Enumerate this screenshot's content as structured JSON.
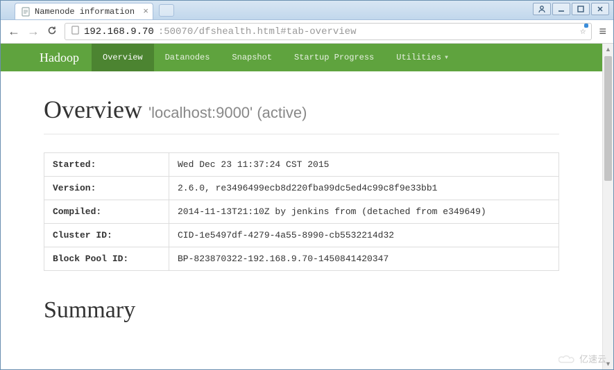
{
  "browser": {
    "tab_title": "Namenode information",
    "url_host": "192.168.9.70",
    "url_rest": ":50070/dfshealth.html#tab-overview"
  },
  "navbar": {
    "brand": "Hadoop",
    "items": [
      {
        "label": "Overview",
        "active": true
      },
      {
        "label": "Datanodes",
        "active": false
      },
      {
        "label": "Snapshot",
        "active": false
      },
      {
        "label": "Startup Progress",
        "active": false
      },
      {
        "label": "Utilities",
        "active": false,
        "dropdown": true
      }
    ]
  },
  "overview": {
    "heading": "Overview",
    "subtitle": "'localhost:9000' (active)",
    "rows": [
      {
        "key": "Started:",
        "value": "Wed Dec 23 11:37:24 CST 2015"
      },
      {
        "key": "Version:",
        "value": "2.6.0, re3496499ecb8d220fba99dc5ed4c99c8f9e33bb1"
      },
      {
        "key": "Compiled:",
        "value": "2014-11-13T21:10Z by jenkins from (detached from e349649)"
      },
      {
        "key": "Cluster ID:",
        "value": "CID-1e5497df-4279-4a55-8990-cb5532214d32"
      },
      {
        "key": "Block Pool ID:",
        "value": "BP-823870322-192.168.9.70-1450841420347"
      }
    ]
  },
  "summary_heading": "Summary",
  "watermark": "亿速云"
}
